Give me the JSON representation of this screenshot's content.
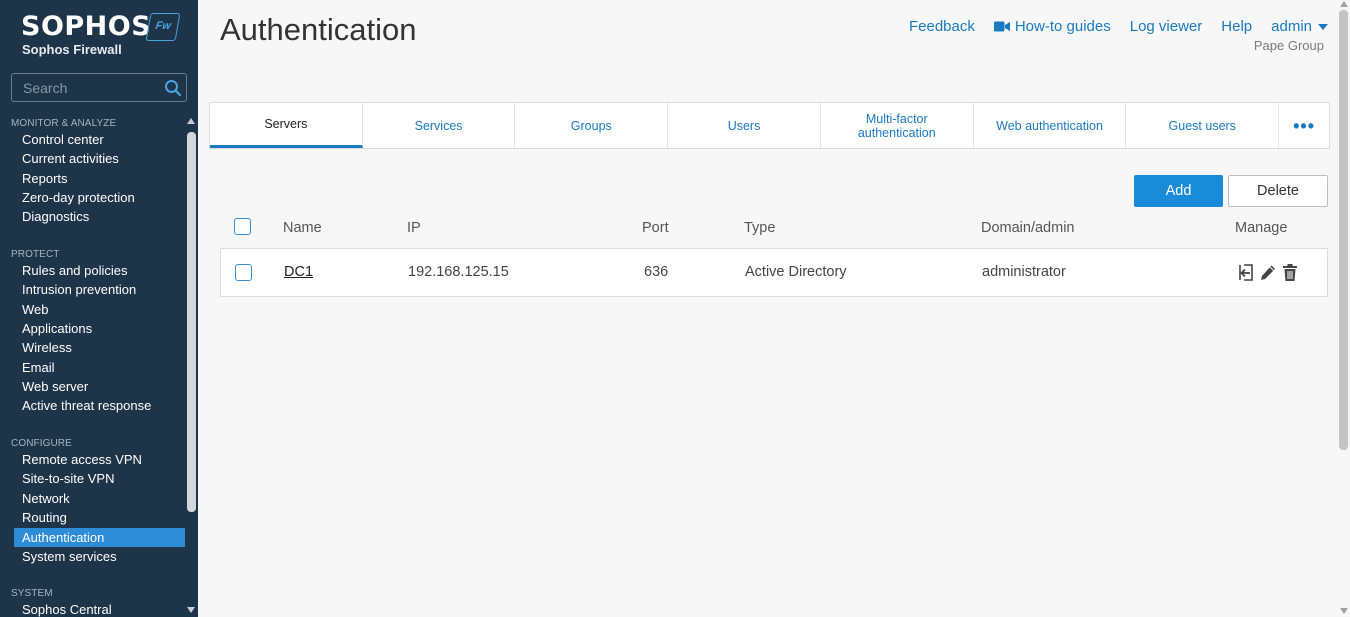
{
  "brand": {
    "logo": "SOPHOS",
    "badge": "Fw",
    "product": "Sophos Firewall"
  },
  "search": {
    "placeholder": "Search"
  },
  "sidebar": {
    "sections": [
      {
        "title": "MONITOR & ANALYZE",
        "items": [
          "Control center",
          "Current activities",
          "Reports",
          "Zero-day protection",
          "Diagnostics"
        ]
      },
      {
        "title": "PROTECT",
        "items": [
          "Rules and policies",
          "Intrusion prevention",
          "Web",
          "Applications",
          "Wireless",
          "Email",
          "Web server",
          "Active threat response"
        ]
      },
      {
        "title": "CONFIGURE",
        "items": [
          "Remote access VPN",
          "Site-to-site VPN",
          "Network",
          "Routing",
          "Authentication",
          "System services"
        ]
      },
      {
        "title": "SYSTEM",
        "items": [
          "Sophos Central"
        ]
      }
    ],
    "active_item": "Authentication"
  },
  "header": {
    "title": "Authentication",
    "links": {
      "feedback": "Feedback",
      "howto": "How-to guides",
      "logviewer": "Log viewer",
      "help": "Help",
      "user": "admin"
    },
    "org": "Pape Group"
  },
  "tabs": [
    {
      "label": "Servers",
      "active": true
    },
    {
      "label": "Services"
    },
    {
      "label": "Groups"
    },
    {
      "label": "Users"
    },
    {
      "label": "Multi-factor authentication"
    },
    {
      "label": "Web authentication"
    },
    {
      "label": "Guest users"
    },
    {
      "label": "•••"
    }
  ],
  "actions": {
    "add": "Add",
    "delete": "Delete"
  },
  "table": {
    "headers": {
      "name": "Name",
      "ip": "IP",
      "port": "Port",
      "type": "Type",
      "domain": "Domain/admin",
      "manage": "Manage"
    },
    "rows": [
      {
        "name": "DC1",
        "ip": "192.168.125.15",
        "port": "636",
        "type": "Active Directory",
        "domain": "administrator"
      }
    ]
  },
  "colors": {
    "sidebar_bg": "#1d3449",
    "accent": "#1a8bd8",
    "link": "#1a7abf",
    "active_nav": "#2d8cd6"
  },
  "icons": {
    "search": "search-icon",
    "video": "video-camera-icon",
    "import": "import-icon",
    "edit": "pencil-icon",
    "delete": "trash-icon"
  }
}
